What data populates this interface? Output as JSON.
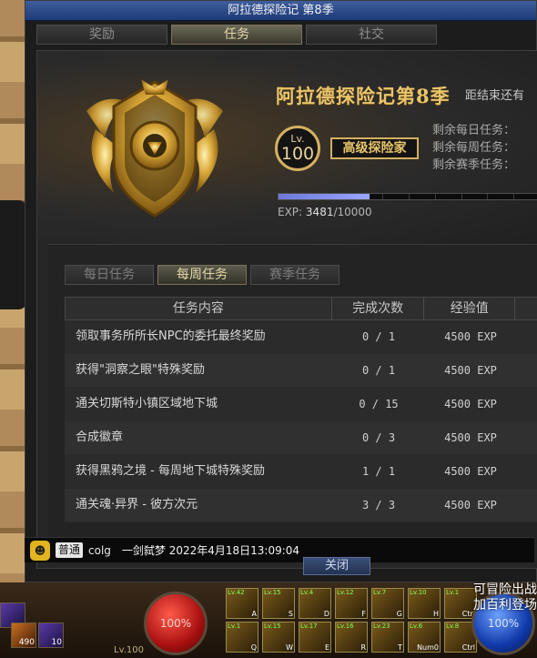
{
  "window": {
    "title": "阿拉德探险记 第8季",
    "tabs": [
      {
        "label": "奖励",
        "active": false
      },
      {
        "label": "任务",
        "active": true
      },
      {
        "label": "社交",
        "active": false
      }
    ],
    "close_label": "关闭"
  },
  "season": {
    "title": "阿拉德探险记第8季",
    "countdown_label": "距结束还有",
    "level_prefix": "Lv.",
    "level": "100",
    "rank": "高级探险家",
    "remaining": [
      {
        "label": "剩余每日任务："
      },
      {
        "label": "剩余每周任务："
      },
      {
        "label": "剩余赛季任务："
      }
    ],
    "exp_label": "EXP:",
    "exp_current": "3481",
    "exp_max": "/10000",
    "exp_progress": 0.348,
    "exp_segments": 10
  },
  "tasks": {
    "tabs": [
      {
        "label": "每日任务",
        "active": false
      },
      {
        "label": "每周任务",
        "active": true
      },
      {
        "label": "赛季任务",
        "active": false
      }
    ],
    "columns": [
      "任务内容",
      "完成次数",
      "经验值",
      ""
    ],
    "rows": [
      {
        "name": "领取事务所所长NPC的委托最终奖励",
        "count": "0 / 1",
        "exp": "4500 EXP"
      },
      {
        "name": "获得\"洞察之眼\"特殊奖励",
        "count": "0 / 1",
        "exp": "4500 EXP"
      },
      {
        "name": "通关切斯特小镇区域地下城",
        "count": "0 / 15",
        "exp": "4500 EXP"
      },
      {
        "name": "合成徽章",
        "count": "0 / 3",
        "exp": "4500 EXP"
      },
      {
        "name": "获得黑鸦之境 - 每周地下城特殊奖励",
        "count": "1 / 1",
        "exp": "4500 EXP"
      },
      {
        "name": "通关魂·异界 - 彼方次元",
        "count": "3 / 3",
        "exp": "4500 EXP"
      }
    ]
  },
  "chat": {
    "channel": "普通",
    "user": "colg",
    "message": "一剑弑梦 2022年4月18日13:09:04"
  },
  "hud": {
    "hp": "100%",
    "mp": "100%",
    "level": "Lv.100",
    "tip": "可冒险出战加百利登场",
    "item_count_1": "490",
    "item_count_2": "10",
    "skill_keys": [
      "A",
      "S",
      "D",
      "F",
      "G",
      "H",
      "Ctrl",
      "Q",
      "W",
      "E",
      "R",
      "T",
      "Num0",
      "Ctrl"
    ],
    "skill_levels": [
      "Lv.42",
      "Lv.15",
      "Lv.4",
      "Lv.12",
      "Lv.7",
      "Lv.10",
      "Lv.1",
      "Lv.1",
      "Lv.15",
      "Lv.17",
      "Lv.16",
      "Lv.23",
      "Lv.6",
      "Lv.8"
    ],
    "colors": {
      "hp": "#a81010",
      "mp": "#1038a8",
      "gold": "#e9c56a"
    }
  }
}
